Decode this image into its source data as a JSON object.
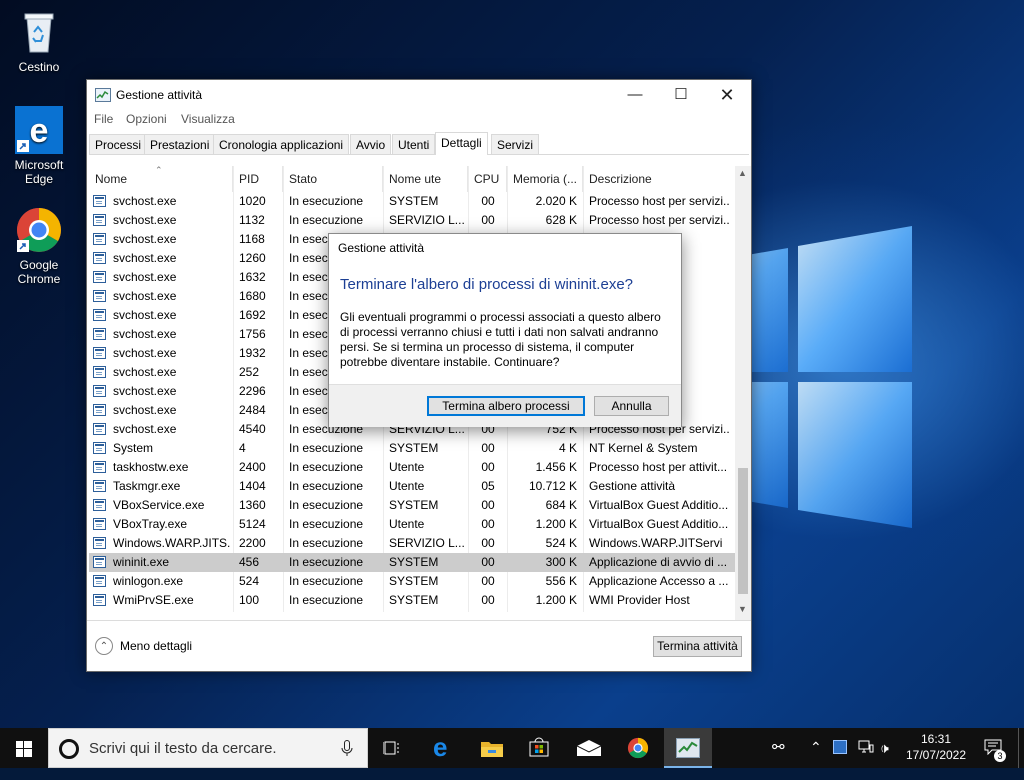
{
  "desktop": {
    "icons": [
      {
        "label": "Cestino"
      },
      {
        "label": "Microsoft Edge"
      },
      {
        "label": "Google Chrome"
      }
    ]
  },
  "taskmgr": {
    "title": "Gestione attività",
    "menu": [
      "File",
      "Opzioni",
      "Visualizza"
    ],
    "tabs": [
      "Processi",
      "Prestazioni",
      "Cronologia applicazioni",
      "Avvio",
      "Utenti",
      "Dettagli",
      "Servizi"
    ],
    "active_tab": "Dettagli",
    "columns": [
      "Nome",
      "PID",
      "Stato",
      "Nome ute",
      "CPU",
      "Memoria (...",
      "Descrizione"
    ],
    "rows": [
      {
        "name": "svchost.exe",
        "pid": "1020",
        "state": "In esecuzione",
        "user": "SYSTEM",
        "cpu": "00",
        "mem": "2.020 K",
        "desc": "Processo host per servizi..."
      },
      {
        "name": "svchost.exe",
        "pid": "1132",
        "state": "In esecuzione",
        "user": "SERVIZIO L...",
        "cpu": "00",
        "mem": "628 K",
        "desc": "Processo host per servizi..."
      },
      {
        "name": "svchost.exe",
        "pid": "1168",
        "state": "In esecuzione",
        "user": "",
        "cpu": "",
        "mem": "",
        "desc": "servizi..."
      },
      {
        "name": "svchost.exe",
        "pid": "1260",
        "state": "In esecuzione",
        "user": "",
        "cpu": "",
        "mem": "",
        "desc": "servizi..."
      },
      {
        "name": "svchost.exe",
        "pid": "1632",
        "state": "In esecuzione",
        "user": "",
        "cpu": "",
        "mem": "",
        "desc": "servizi..."
      },
      {
        "name": "svchost.exe",
        "pid": "1680",
        "state": "In esecuzione",
        "user": "",
        "cpu": "",
        "mem": "",
        "desc": "servizi..."
      },
      {
        "name": "svchost.exe",
        "pid": "1692",
        "state": "In esecuzione",
        "user": "",
        "cpu": "",
        "mem": "",
        "desc": "servizi..."
      },
      {
        "name": "svchost.exe",
        "pid": "1756",
        "state": "In esecuzione",
        "user": "",
        "cpu": "",
        "mem": "",
        "desc": "servizi..."
      },
      {
        "name": "svchost.exe",
        "pid": "1932",
        "state": "In esecuzione",
        "user": "",
        "cpu": "",
        "mem": "",
        "desc": "servizi..."
      },
      {
        "name": "svchost.exe",
        "pid": "252",
        "state": "In esecuzione",
        "user": "",
        "cpu": "",
        "mem": "",
        "desc": "servizi..."
      },
      {
        "name": "svchost.exe",
        "pid": "2296",
        "state": "In esecuzione",
        "user": "",
        "cpu": "",
        "mem": "",
        "desc": "servizi..."
      },
      {
        "name": "svchost.exe",
        "pid": "2484",
        "state": "In esecuzione",
        "user": "",
        "cpu": "",
        "mem": "",
        "desc": "servizi..."
      },
      {
        "name": "svchost.exe",
        "pid": "4540",
        "state": "In esecuzione",
        "user": "SERVIZIO L...",
        "cpu": "00",
        "mem": "752 K",
        "desc": "Processo host per servizi..."
      },
      {
        "name": "System",
        "pid": "4",
        "state": "In esecuzione",
        "user": "SYSTEM",
        "cpu": "00",
        "mem": "4 K",
        "desc": "NT Kernel & System"
      },
      {
        "name": "taskhostw.exe",
        "pid": "2400",
        "state": "In esecuzione",
        "user": "Utente",
        "cpu": "00",
        "mem": "1.456 K",
        "desc": "Processo host per attivit..."
      },
      {
        "name": "Taskmgr.exe",
        "pid": "1404",
        "state": "In esecuzione",
        "user": "Utente",
        "cpu": "05",
        "mem": "10.712 K",
        "desc": "Gestione attività"
      },
      {
        "name": "VBoxService.exe",
        "pid": "1360",
        "state": "In esecuzione",
        "user": "SYSTEM",
        "cpu": "00",
        "mem": "684 K",
        "desc": "VirtualBox Guest Additio..."
      },
      {
        "name": "VBoxTray.exe",
        "pid": "5124",
        "state": "In esecuzione",
        "user": "Utente",
        "cpu": "00",
        "mem": "1.200 K",
        "desc": "VirtualBox Guest Additio..."
      },
      {
        "name": "Windows.WARP.JITS...",
        "pid": "2200",
        "state": "In esecuzione",
        "user": "SERVIZIO L...",
        "cpu": "00",
        "mem": "524 K",
        "desc": "Windows.WARP.JITServi"
      },
      {
        "name": "wininit.exe",
        "pid": "456",
        "state": "In esecuzione",
        "user": "SYSTEM",
        "cpu": "00",
        "mem": "300 K",
        "desc": "Applicazione di avvio di ..."
      },
      {
        "name": "winlogon.exe",
        "pid": "524",
        "state": "In esecuzione",
        "user": "SYSTEM",
        "cpu": "00",
        "mem": "556 K",
        "desc": "Applicazione Accesso a ..."
      },
      {
        "name": "WmiPrvSE.exe",
        "pid": "100",
        "state": "In esecuzione",
        "user": "SYSTEM",
        "cpu": "00",
        "mem": "1.200 K",
        "desc": "WMI Provider Host"
      }
    ],
    "selected_name": "wininit.exe",
    "less_details": "Meno dettagli",
    "end_task": "Termina attività"
  },
  "dialog": {
    "caption": "Gestione attività",
    "heading": "Terminare l'albero di processi di wininit.exe?",
    "body": "Gli eventuali programmi o processi associati a questo albero di processi verranno chiusi e tutti i dati non salvati andranno persi. Se si termina un processo di sistema, il computer potrebbe diventare instabile. Continuare?",
    "confirm": "Termina albero processi",
    "cancel": "Annulla"
  },
  "taskbar": {
    "search_placeholder": "Scrivi qui il testo da cercare.",
    "time": "16:31",
    "date": "17/07/2022",
    "notifications": "3"
  },
  "colors": {
    "accent": "#0078d7",
    "taskbar": "#101010",
    "selection": "#cccccc"
  }
}
